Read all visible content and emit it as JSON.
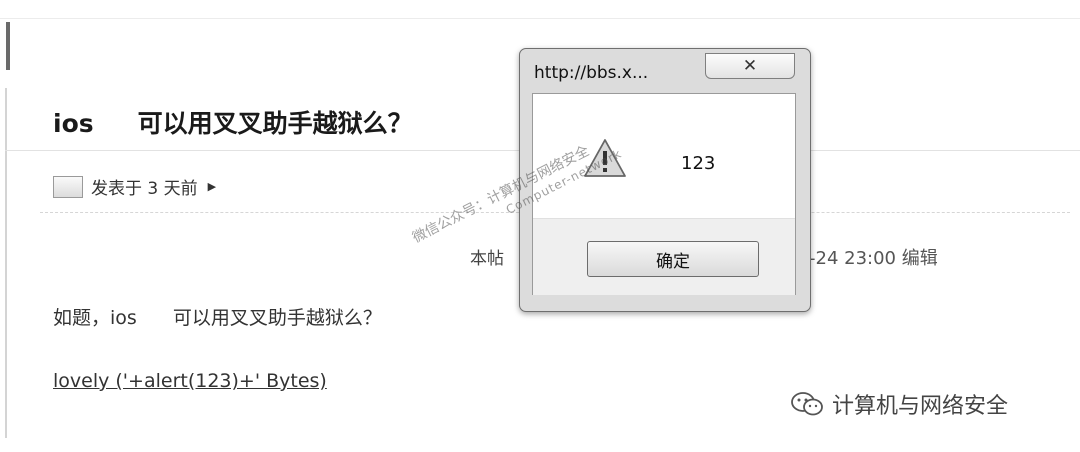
{
  "post": {
    "title_prefix": "ios",
    "title_main": "可以用叉叉助手越狱么？",
    "meta_text": "发表于 3 天前",
    "edit_fragment": "本帖",
    "edit_note": "-24 23:00 编辑",
    "body_prefix": "如题，ios",
    "body_main": "可以用叉叉助手越狱么？",
    "link_text": "lovely ('+alert(123)+' Bytes)"
  },
  "dialog": {
    "title": "http://bbs.x...",
    "close_glyph": "✕",
    "message": "123",
    "ok_label": "确定"
  },
  "watermark": {
    "line1": "微信公众号：计算机与网络安全",
    "line2": "Computer-network"
  },
  "brand": {
    "label": "计算机与网络安全"
  },
  "colors": {
    "page_bg": "#ffffff",
    "dialog_frame": "#dcdcdc",
    "button_area": "#efefef"
  }
}
